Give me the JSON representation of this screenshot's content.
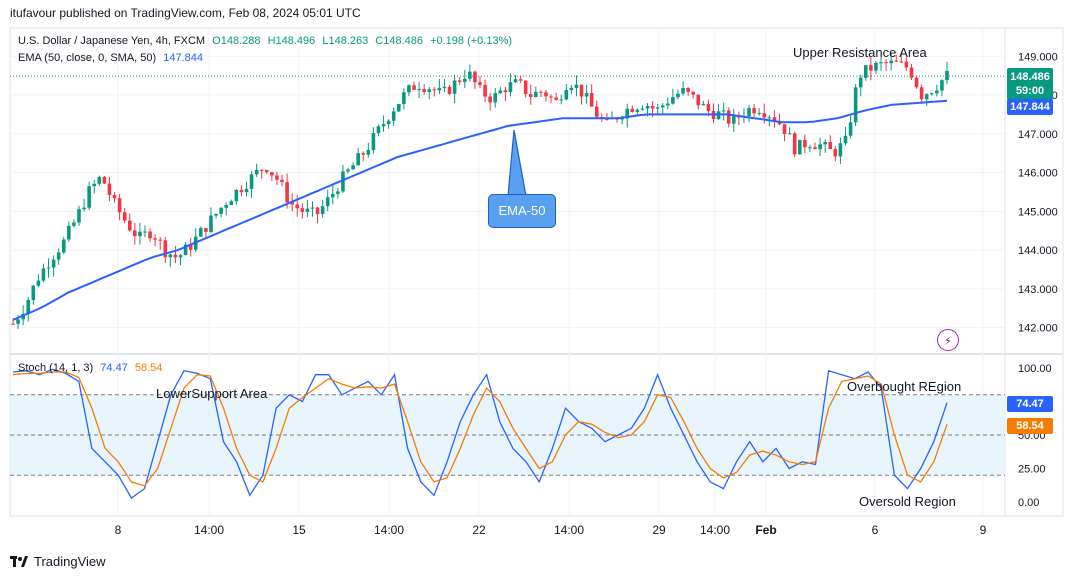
{
  "publisher": "itufavour published on TradingView.com, Feb 08, 2024 05:01 UTC",
  "footer": "TradingView",
  "legend": {
    "symbol": "U.S. Dollar / Japanese Yen, 4h, FXCM",
    "open": "O148.288",
    "high": "H148.496",
    "low": "L148.263",
    "close": "C148.486",
    "change": "+0.198 (+0.13%)",
    "ema_label": "EMA (50, close, 0, SMA, 50)",
    "ema_value": "147.844",
    "stoch_label": "Stoch (14, 1, 3)",
    "stoch_k": "74.47",
    "stoch_d": "58.54"
  },
  "price_tags": {
    "last_price": "148.486",
    "countdown": "59:00",
    "ema": "147.844",
    "stoch_k": "74.47",
    "stoch_d": "58.54"
  },
  "annotations": {
    "upper_resistance": "Upper Resistance Area",
    "ema_callout": "EMA-50",
    "lower_support": "LowerSupport Area",
    "overbought": "Overbought REgion",
    "oversold": "Oversold Region"
  },
  "colors": {
    "up": "#089981",
    "down": "#f23645",
    "ema": "#2962ff",
    "stoch_k": "#2962ff",
    "stoch_d": "#f57c00",
    "band": "#e3f2fd"
  },
  "chart_data": [
    {
      "type": "candlestick",
      "symbol": "USD/JPY",
      "timeframe": "4h",
      "ylim": [
        141.5,
        149.6
      ],
      "y_ticks": [
        "149.000",
        "148.000",
        "147.000",
        "146.000",
        "145.000",
        "144.000",
        "143.000",
        "142.000"
      ],
      "x_ticks": [
        "8",
        "14:00",
        "15",
        "14:00",
        "22",
        "14:00",
        "29",
        "14:00",
        "Feb",
        "6",
        "9"
      ],
      "close_path": [
        142.1,
        142.6,
        143.3,
        143.8,
        144.2,
        144.8,
        145.5,
        145.9,
        145.2,
        144.7,
        144.3,
        144.5,
        144.0,
        143.8,
        144.1,
        144.5,
        144.9,
        145.3,
        145.6,
        145.9,
        146.2,
        145.8,
        145.2,
        145.0,
        144.9,
        145.3,
        145.8,
        146.2,
        146.6,
        147.1,
        147.6,
        148.0,
        148.3,
        148.2,
        148.0,
        148.3,
        148.6,
        148.1,
        147.9,
        148.2,
        148.3,
        148.0,
        148.1,
        147.8,
        148.4,
        148.1,
        147.6,
        147.2,
        147.5,
        147.7,
        147.8,
        147.6,
        147.9,
        148.1,
        147.9,
        147.6,
        147.5,
        147.3,
        147.6,
        147.7,
        147.5,
        147.2,
        146.6,
        146.8,
        146.7,
        146.5,
        146.8,
        148.5,
        148.7,
        148.8,
        148.8,
        148.7,
        148.0,
        148.2,
        148.5
      ],
      "ema_path": [
        142.2,
        142.5,
        142.9,
        143.2,
        143.5,
        143.8,
        144.0,
        144.3,
        144.6,
        144.9,
        145.2,
        145.5,
        145.8,
        146.1,
        146.4,
        146.6,
        146.8,
        147.0,
        147.2,
        147.3,
        147.4,
        147.4,
        147.4,
        147.5,
        147.5,
        147.5,
        147.5,
        147.4,
        147.3,
        147.3,
        147.4,
        147.6,
        147.75,
        147.8,
        147.85
      ]
    },
    {
      "type": "line",
      "title": "Stoch (14, 1, 3)",
      "ylim": [
        0,
        100
      ],
      "y_ticks": [
        "100.00",
        "75.00",
        "50.00",
        "25.00",
        "0.00"
      ],
      "bands": [
        20,
        80
      ],
      "series": [
        {
          "name": "%K",
          "values": [
            97,
            98,
            95,
            99,
            96,
            90,
            40,
            30,
            20,
            3,
            10,
            45,
            80,
            98,
            96,
            92,
            45,
            30,
            5,
            20,
            70,
            80,
            75,
            95,
            95,
            80,
            85,
            90,
            80,
            95,
            40,
            15,
            5,
            30,
            60,
            80,
            95,
            60,
            40,
            30,
            15,
            40,
            70,
            60,
            55,
            45,
            50,
            55,
            70,
            95,
            70,
            50,
            30,
            15,
            10,
            30,
            45,
            30,
            40,
            25,
            30,
            28,
            98,
            95,
            92,
            97,
            85,
            20,
            10,
            25,
            45,
            74
          ]
        },
        {
          "name": "%D",
          "values": [
            95,
            96,
            96,
            97,
            97,
            93,
            70,
            40,
            30,
            15,
            12,
            25,
            55,
            85,
            95,
            94,
            70,
            40,
            20,
            15,
            40,
            70,
            78,
            85,
            92,
            88,
            85,
            86,
            85,
            88,
            60,
            30,
            15,
            18,
            40,
            65,
            85,
            75,
            55,
            40,
            25,
            30,
            50,
            60,
            58,
            52,
            48,
            50,
            60,
            80,
            78,
            60,
            40,
            25,
            18,
            22,
            35,
            38,
            35,
            30,
            28,
            30,
            70,
            90,
            92,
            94,
            88,
            50,
            20,
            15,
            30,
            58
          ]
        }
      ]
    }
  ]
}
